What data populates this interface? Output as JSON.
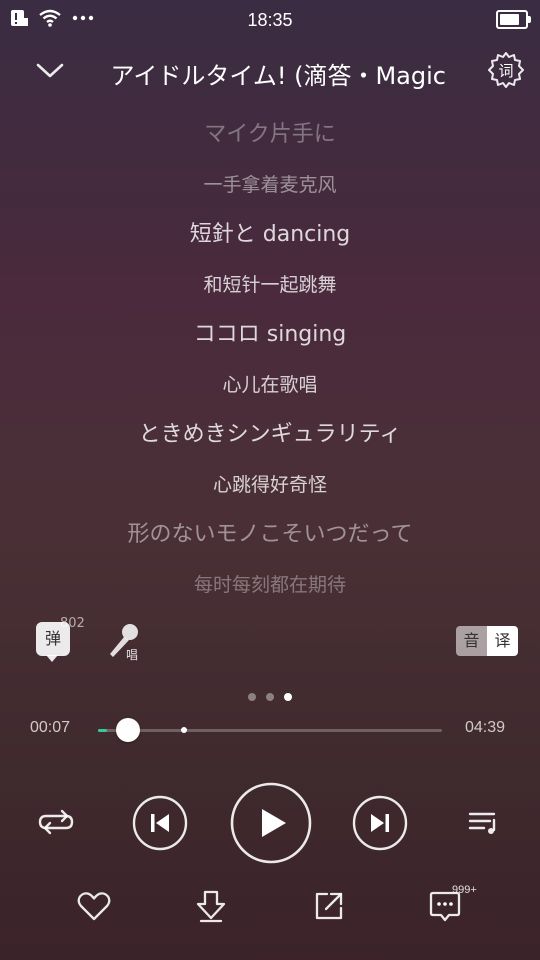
{
  "status_bar": {
    "time": "18:35",
    "battery_level": 0.85
  },
  "header": {
    "title": "アイドルタイム! (滴答・Magic"
  },
  "lyrics": [
    {
      "jp": "マイク片手に",
      "cn": "一手拿着麦克风"
    },
    {
      "jp": "短針と dancing",
      "cn": "和短针一起跳舞"
    },
    {
      "jp": "ココロ singing",
      "cn": "心儿在歌唱"
    },
    {
      "jp": "ときめきシンギュラリティ",
      "cn": "心跳得好奇怪"
    },
    {
      "jp": "形のないモノこそいつだって",
      "cn": "每时每刻都在期待"
    }
  ],
  "danmu": {
    "label": "弹",
    "count": "802"
  },
  "sing": {
    "label": "唱"
  },
  "lang_toggle": {
    "yin": "音",
    "yi": "译",
    "active": "译"
  },
  "pager": {
    "count": 3,
    "active": 2
  },
  "progress": {
    "current": "00:07",
    "total": "04:39",
    "played_fraction": 0.025,
    "buffer_fraction": 0.24
  },
  "comments": {
    "count": "999+"
  },
  "colors": {
    "accent": "#35c9a0"
  },
  "icons": {
    "collapse": "chevron-down-icon",
    "settings": "lyrics-settings-icon",
    "repeat": "repeat-icon",
    "prev": "skip-previous-icon",
    "play": "play-icon",
    "next": "skip-next-icon",
    "queue": "playlist-icon",
    "like": "heart-icon",
    "download": "download-icon",
    "share": "share-icon",
    "comment": "comment-icon"
  }
}
